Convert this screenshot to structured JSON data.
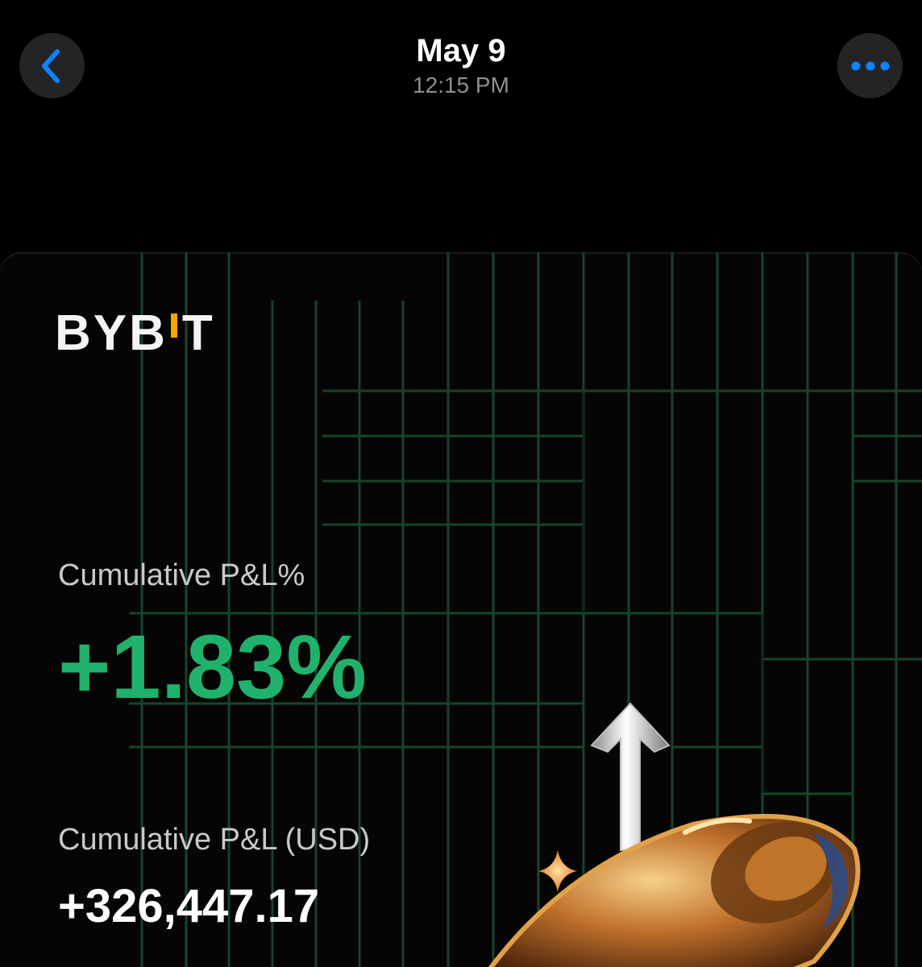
{
  "header": {
    "date": "May 9",
    "time": "12:15 PM"
  },
  "card": {
    "logo_text_left": "BYB",
    "logo_text_right": "T",
    "pnl_percent_label": "Cumulative P&L%",
    "pnl_percent_value": "+1.83%",
    "pnl_usd_label": "Cumulative P&L (USD)",
    "pnl_usd_value": "+326,447.17"
  },
  "icons": {
    "back": "chevron-left-icon",
    "more": "ellipsis-icon",
    "arrow": "up-arrow-icon",
    "sparkle": "sparkle-icon",
    "rocket": "rocket-icon"
  },
  "colors": {
    "accent_blue": "#0a84ff",
    "profit_green": "#20b26c",
    "logo_accent": "#f7a600",
    "grid_green": "#16442a"
  }
}
